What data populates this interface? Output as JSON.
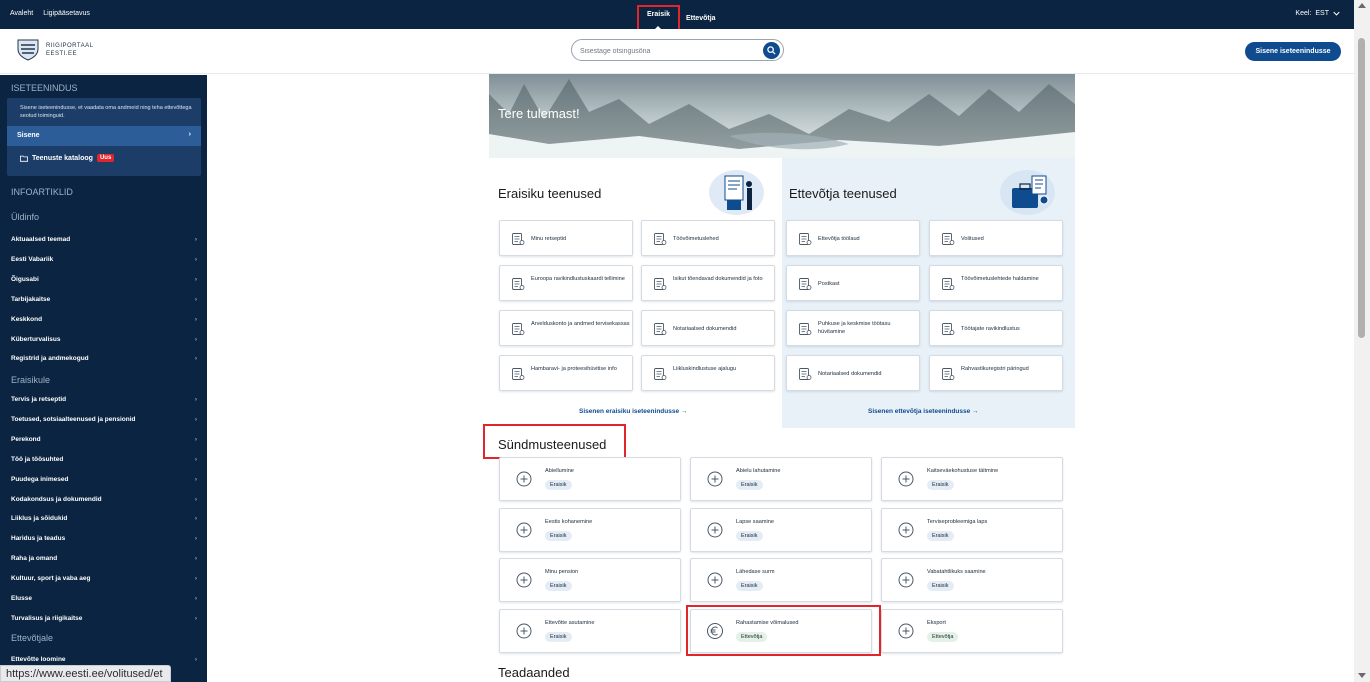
{
  "topbar": {
    "home": "Avaleht",
    "accessibility": "Ligipääsetavus",
    "tab_private": "Eraisik",
    "tab_business": "Ettevõtja",
    "language_label": "Keel:",
    "language_value": "EST"
  },
  "header": {
    "logo_line1": "RIIGIPORTAAL",
    "logo_line2": "EESTI.EE",
    "search_placeholder": "Sisestage otsingusõna",
    "login_button": "Sisene iseteenindusse"
  },
  "sidebar": {
    "section_iseteenindus": "ISETEENINDUS",
    "iseteenindus_desc": "Sisene iseteenindusse, et vaadata oma andmeid ning teha ettevõttega seotud toiminguid.",
    "sisene": "Sisene",
    "katalog": "Teenuste kataloog",
    "katalog_badge": "Uus",
    "section_infoartiklid": "INFOARTIKLID",
    "group_uldinfo": "Üldinfo",
    "uldinfo_items": [
      "Aktuaalsed teemad",
      "Eesti Vabariik",
      "Õigusabi",
      "Tarbijakaitse",
      "Keskkond",
      "Küberturvalisus",
      "Registrid ja andmekogud"
    ],
    "group_eraisikule": "Eraisikule",
    "eraisikule_items": [
      "Tervis ja retseptid",
      "Toetused, sotsiaalteenused ja pensionid",
      "Perekond",
      "Töö ja töösuhted",
      "Puudega inimesed",
      "Kodakondsus ja dokumendid",
      "Liiklus ja sõidukid",
      "Haridus ja teadus",
      "Raha ja omand",
      "Kultuur, sport ja vaba aeg",
      "Elusse",
      "Turvalisus ja riigikaitse"
    ],
    "group_ettevotjale": "Ettevõtjale",
    "ettevotjale_items": [
      "Ettevõtte loomine"
    ],
    "status_url": "https://www.eesti.ee/volitused/et"
  },
  "hero": {
    "title": "Tere tulemast!"
  },
  "services_private": {
    "title": "Eraisiku teenused",
    "tiles": [
      "Minu retseptid",
      "Töövõimetuslehed",
      "Euroopa ravikindlustuskaardi tellimine",
      "Isikut tõendavad dokumendid ja foto",
      "Arvelduskonto ja andmed tervisekassas",
      "Notariaalsed dokumendid",
      "Hambaravi- ja proteesihüvitise info",
      "Liikluskindlustuse ajalugu"
    ],
    "link": "Sisenen eraisiku iseteenindusse →"
  },
  "services_business": {
    "title": "Ettevõtja teenused",
    "tiles": [
      "Ettevõtja töölaud",
      "Volitused",
      "Postkast",
      "Töövõimetuslehtede haldamine",
      "Puhkuse ja keskmise töötasu hüvitamine",
      "Töötajate ravikindlustus",
      "Notariaalsed dokumendid",
      "Rahvastikuregistri päringud"
    ],
    "link": "Sisenen ettevõtja iseteenindusse →"
  },
  "life_events": {
    "title": "Sündmusteenused",
    "items": [
      {
        "label": "Abiellumine",
        "tag": "Eraisik"
      },
      {
        "label": "Abielu lahutamine",
        "tag": "Eraisik"
      },
      {
        "label": "Kaitseväekohustuse täitmine",
        "tag": "Eraisik"
      },
      {
        "label": "Eestis kohanemine",
        "tag": "Eraisik"
      },
      {
        "label": "Lapse saamine",
        "tag": "Eraisik"
      },
      {
        "label": "Terviseprobleemiga laps",
        "tag": "Eraisik"
      },
      {
        "label": "Minu pension",
        "tag": "Eraisik"
      },
      {
        "label": "Lähedase surm",
        "tag": "Eraisik"
      },
      {
        "label": "Vabatahtlikuks saamine",
        "tag": "Eraisik"
      },
      {
        "label": "Ettevõtte asutamine",
        "tag": "Eraisik"
      },
      {
        "label": "Rahastamise võimalused",
        "tag": "Ettevõtja"
      },
      {
        "label": "Eksport",
        "tag": "Ettevõtja"
      }
    ]
  },
  "announcements": {
    "title": "Teadaanded"
  },
  "colors": {
    "navy": "#0a2441",
    "primary_blue": "#0f4b8f",
    "highlight_red": "#e0262b"
  }
}
